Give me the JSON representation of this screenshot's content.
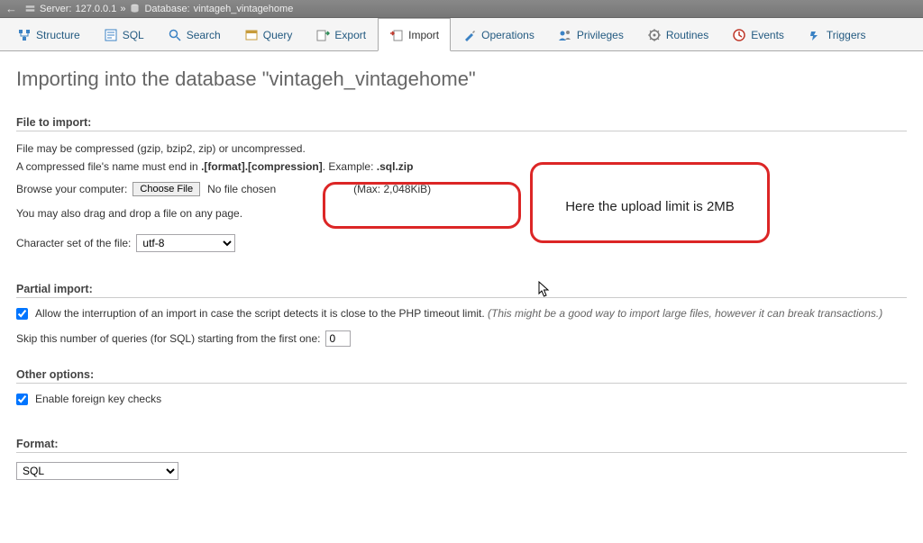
{
  "breadcrumb": {
    "server_label": "Server:",
    "server_value": "127.0.0.1",
    "separator": "»",
    "db_label": "Database:",
    "db_value": "vintageh_vintagehome"
  },
  "tabs": [
    {
      "label": "Structure",
      "icon": "structure"
    },
    {
      "label": "SQL",
      "icon": "sql"
    },
    {
      "label": "Search",
      "icon": "search"
    },
    {
      "label": "Query",
      "icon": "query"
    },
    {
      "label": "Export",
      "icon": "export"
    },
    {
      "label": "Import",
      "icon": "import"
    },
    {
      "label": "Operations",
      "icon": "operations"
    },
    {
      "label": "Privileges",
      "icon": "privileges"
    },
    {
      "label": "Routines",
      "icon": "routines"
    },
    {
      "label": "Events",
      "icon": "events"
    },
    {
      "label": "Triggers",
      "icon": "triggers"
    }
  ],
  "active_tab_index": 5,
  "heading": "Importing into the database \"vintageh_vintagehome\"",
  "file_section": {
    "title": "File to import:",
    "hint1": "File may be compressed (gzip, bzip2, zip) or uncompressed.",
    "hint2_pre": "A compressed file's name must end in ",
    "hint2_bold": ".[format].[compression]",
    "hint2_mid": ". Example: ",
    "hint2_ex": ".sql.zip",
    "browse_label": "Browse your computer:",
    "choose_btn": "Choose File",
    "file_status": "No file chosen",
    "max_size": "(Max: 2,048KiB)",
    "drag_hint": "You may also drag and drop a file on any page.",
    "charset_label": "Character set of the file:",
    "charset_value": "utf-8"
  },
  "partial_section": {
    "title": "Partial import:",
    "allow_label_pre": "Allow the interruption of an import in case the script detects it is close to the PHP timeout limit. ",
    "allow_label_italic": "(This might be a good way to import large files, however it can break transactions.)",
    "allow_checked": true,
    "skip_label": "Skip this number of queries (for SQL) starting from the first one:",
    "skip_value": "0"
  },
  "other_section": {
    "title": "Other options:",
    "fk_label": "Enable foreign key checks",
    "fk_checked": true
  },
  "format_section": {
    "title": "Format:",
    "value": "SQL"
  },
  "annotation": {
    "text": "Here the upload limit is 2MB"
  },
  "icon_colors": {
    "structure": "#3b82c4",
    "sql": "#3b82c4",
    "search": "#3b82c4",
    "query": "#c79b3b",
    "export": "#2e8b57",
    "import": "#c0392b",
    "operations": "#3b82c4",
    "privileges": "#3b82c4",
    "routines": "#777",
    "events": "#c0392b",
    "triggers": "#3b82c4"
  }
}
